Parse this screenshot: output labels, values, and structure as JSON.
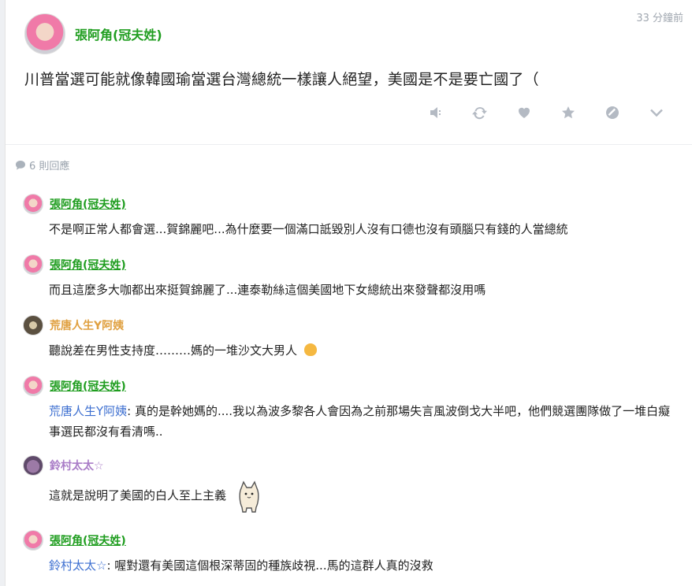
{
  "post": {
    "author": "張阿角(冠夫姓)",
    "timestamp": "33 分鐘前",
    "text": "川普當選可能就像韓國瑜當選台灣總統一樣讓人絕望，美國是不是要亡國了（"
  },
  "actions": [
    "mute-icon",
    "repost-icon",
    "heart-icon",
    "star-icon",
    "block-icon",
    "chevron-down-icon"
  ],
  "replies_label": "6 則回應",
  "comments": [
    {
      "author": "張阿角(冠夫姓)",
      "mention": "",
      "text": "不是啊正常人都會選...賀錦麗吧...為什麼要一個滿口詆毀別人沒有口德也沒有頭腦只有錢的人當總統"
    },
    {
      "author": "張阿角(冠夫姓)",
      "mention": "",
      "text": "而且這麼多大咖都出來挺賀錦麗了...連泰勒絲這個美國地下女總統出來發聲都沒用嗎"
    },
    {
      "author": "荒唐人生Y阿姨",
      "mention": "",
      "text": "聽說差在男性支持度………媽的一堆沙文大男人"
    },
    {
      "author": "張阿角(冠夫姓)",
      "mention": "荒唐人生Y阿姨",
      "text": "真的是幹她媽的....我以為波多黎各人會因為之前那場失言風波倒戈大半吧，他們競選團隊做了一堆白癡事選民都沒有看清嗎.."
    },
    {
      "author": "鈴村太太☆",
      "mention": "",
      "text": "這就是說明了美國的白人至上主義"
    },
    {
      "author": "張阿角(冠夫姓)",
      "mention": "鈴村太太☆",
      "text": "喔對還有美國這個根深蒂固的種族歧視...馬的這群人真的沒救"
    }
  ]
}
